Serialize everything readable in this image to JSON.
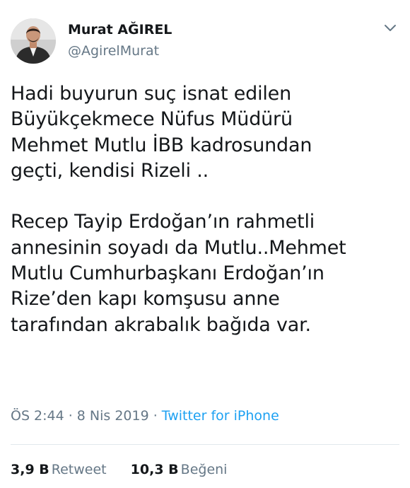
{
  "author": {
    "name": "Murat AĞIREL",
    "handle": "@AgirelMurat"
  },
  "tweet": {
    "paragraph1": "Hadi buyurun suç isnat edilen\nBüyükçekmece Nüfus Müdürü\nMehmet Mutlu İBB kadrosundan\ngeçti, kendisi Rizeli ..",
    "paragraph2": "Recep Tayip Erdoğan’ın rahmetli\nannesinin soyadı da Mutlu..Mehmet\nMutlu Cumhurbaşkanı Erdoğan’ın\nRize’den kapı komşusu anne\ntarafından akrabalık bağıda var."
  },
  "meta": {
    "time": "ÖS 2:44",
    "separator": "·",
    "date": "8 Nis 2019",
    "source": "Twitter for iPhone"
  },
  "stats": {
    "retweets_count": "3,9 B",
    "retweets_label": "Retweet",
    "likes_count": "10,3 B",
    "likes_label": "Beğeni"
  },
  "icons": {
    "menu": "chevron-down-icon",
    "avatar": "profile-photo"
  },
  "colors": {
    "text": "#14171a",
    "secondary": "#657786",
    "link": "#1da1f2",
    "divider": "#e1e8ed"
  }
}
